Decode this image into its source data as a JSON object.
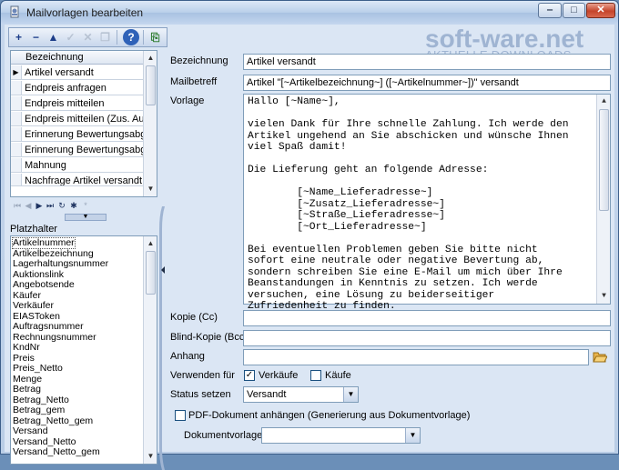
{
  "window": {
    "title": "Mailvorlagen bearbeiten",
    "accent": "#3d5f8a"
  },
  "toolbar": {
    "buttons": [
      "+",
      "−",
      "▲",
      "✓",
      "✕",
      "❐",
      "?",
      "⎘"
    ]
  },
  "logo": {
    "main": "soft-ware.net",
    "sub": "AKTUELLE DOWNLOADS"
  },
  "templates": {
    "header": "Bezeichnung",
    "rows": [
      "Artikel versandt",
      "Endpreis anfragen",
      "Endpreis mitteilen",
      "Endpreis mitteilen (Zus. Aukt",
      "Erinnerung Bewertungsabga",
      "Erinnerung Bewertungsabga",
      "Mahnung",
      "Nachfrage Artikel versandt"
    ],
    "selected_index": 0
  },
  "placeholders": {
    "label": "Platzhalter",
    "items": [
      "Artikelnummer",
      "Artikelbezeichnung",
      "Lagerhaltungsnummer",
      "Auktionslink",
      "Angebotsende",
      "Käufer",
      "Verkäufer",
      "EIASToken",
      "Auftragsnummer",
      "Rechnungsnummer",
      "KndNr",
      "Preis",
      "Preis_Netto",
      "Menge",
      "Betrag",
      "Betrag_Netto",
      "Betrag_gem",
      "Betrag_Netto_gem",
      "Versand",
      "Versand_Netto",
      "Versand_Netto_gem"
    ]
  },
  "form": {
    "bezeichnung_label": "Bezeichnung",
    "bezeichnung_value": "Artikel versandt",
    "mailbetreff_label": "Mailbetreff",
    "mailbetreff_value": "Artikel \"[~Artikelbezeichnung~] ([~Artikelnummer~])\" versandt",
    "vorlage_label": "Vorlage",
    "vorlage_text": "Hallo [~Name~],\n\nvielen Dank für Ihre schnelle Zahlung. Ich werde den\nArtikel ungehend an Sie abschicken und wünsche Ihnen\nviel Spaß damit!\n\nDie Lieferung geht an folgende Adresse:\n\n        [~Name_Lieferadresse~]\n        [~Zusatz_Lieferadresse~]\n        [~Straße_Lieferadresse~]\n        [~Ort_Lieferadresse~]\n\nBei eventuellen Problemen geben Sie bitte nicht\nsofort eine neutrale oder negative Bevertung ab,\nsondern schreiben Sie eine E-Mail um mich über Ihre\nBeanstandungen in Kenntnis zu setzen. Ich werde\nversuchen, eine Lösung zu beiderseitiger\nZufriedenheit zu finden.",
    "kopie_label": "Kopie (Cc)",
    "kopie_value": "",
    "blindkopie_label": "Blind-Kopie (Bcc)",
    "blindkopie_value": "",
    "anhang_label": "Anhang",
    "anhang_value": "",
    "verwenden_label": "Verwenden für",
    "verkaeufe_label": "Verkäufe",
    "verkaeufe_checked": true,
    "kaeufe_label": "Käufe",
    "kaeufe_checked": false,
    "status_label": "Status setzen",
    "status_value": "Versandt",
    "pdf_label": "PDF-Dokument anhängen (Generierung aus Dokumentvorlage)",
    "pdf_checked": false,
    "dokumentvorlage_label": "Dokumentvorlage",
    "dokumentvorlage_value": ""
  }
}
